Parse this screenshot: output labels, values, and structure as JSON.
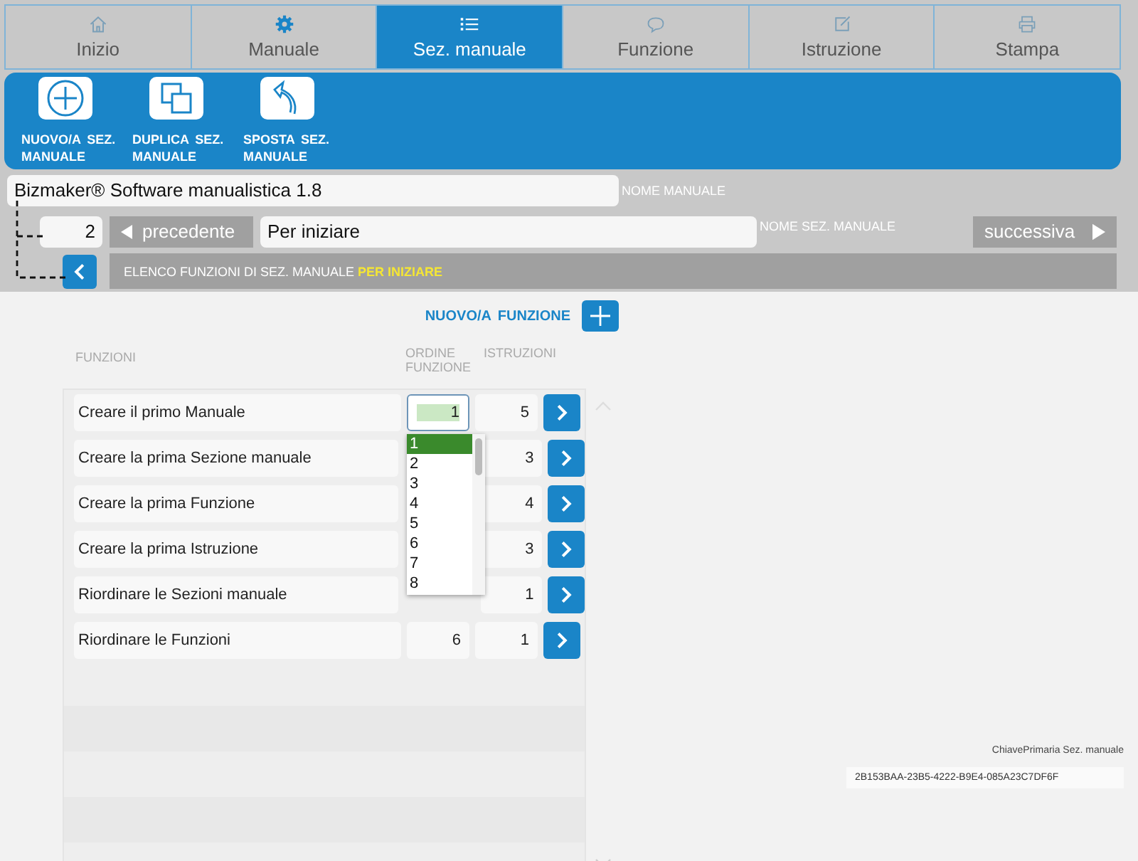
{
  "tabs": [
    {
      "label": "Inizio",
      "kind": "home",
      "selected": false
    },
    {
      "label": "Manuale",
      "kind": "gear",
      "selected": false
    },
    {
      "label": "Sez. manuale",
      "kind": "list",
      "selected": true
    },
    {
      "label": "Funzione",
      "kind": "bubble",
      "selected": false
    },
    {
      "label": "Istruzione",
      "kind": "edit",
      "selected": false
    },
    {
      "label": "Stampa",
      "kind": "printer",
      "selected": false
    }
  ],
  "toolbar": [
    {
      "kind": "plus",
      "label": "NUOVO/A  SEZ. MANUALE"
    },
    {
      "kind": "copy",
      "label": "DUPLICA SEZ. MANUALE"
    },
    {
      "kind": "arrow",
      "label": "SPOSTA SEZ. MANUALE"
    }
  ],
  "manual_name": {
    "value": "Bizmaker® Software manualistica 1.8",
    "label": "NOME MANUALE"
  },
  "section": {
    "number": "2",
    "previous": "precedente",
    "name": "Per iniziare",
    "label": "NOME SEZ. MANUALE",
    "next": "successiva"
  },
  "list_header": {
    "text": "ELENCO FUNZIONI DI SEZ. MANUALE",
    "highlight": "PER INIZIARE"
  },
  "new_function": "NUOVO/A  FUNZIONE",
  "columns": [
    "FUNZIONI",
    "ORDINE FUNZIONE",
    "ISTRUZIONI"
  ],
  "rows": [
    {
      "name": "Creare il primo Manuale",
      "order": "1",
      "instructions": "5",
      "editing": true
    },
    {
      "name": "Creare la prima Sezione manuale",
      "instructions": "3"
    },
    {
      "name": "Creare la prima Funzione",
      "instructions": "4"
    },
    {
      "name": "Creare la prima Istruzione",
      "instructions": "3"
    },
    {
      "name": "Riordinare le Sezioni manuale",
      "instructions": "1"
    },
    {
      "name": "Riordinare le Funzioni",
      "order": "6",
      "instructions": "1",
      "editing": false
    }
  ],
  "dropdown": [
    {
      "label": "1",
      "selected": true
    },
    {
      "label": "2",
      "selected": false
    },
    {
      "label": "3",
      "selected": false
    },
    {
      "label": "4",
      "selected": false
    },
    {
      "label": "5",
      "selected": false
    },
    {
      "label": "6",
      "selected": false
    },
    {
      "label": "7",
      "selected": false
    },
    {
      "label": "8",
      "selected": false
    }
  ],
  "primary_key": {
    "label": "ChiavePrimaria Sez. manuale",
    "value": "2B153BAA-23B5-4222-B9E4-085A23C7DF6F"
  }
}
